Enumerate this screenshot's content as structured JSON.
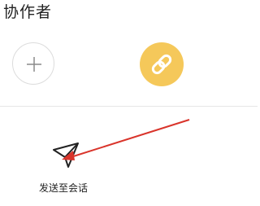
{
  "section": {
    "title": "协作者"
  },
  "actions": {
    "add_icon": "plus-icon",
    "link_icon": "link-icon",
    "link_color": "#f5c85a",
    "send_label": "发送至会话",
    "send_icon": "paper-plane-icon"
  },
  "annotation": {
    "color": "#d9342b"
  }
}
